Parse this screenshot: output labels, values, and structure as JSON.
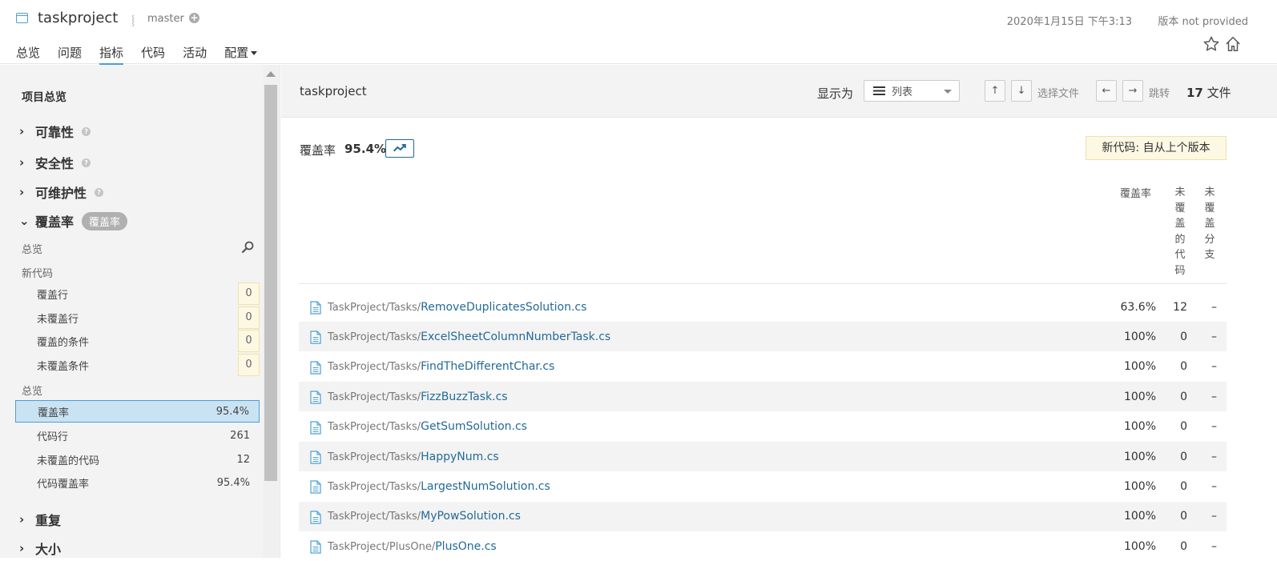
{
  "header": {
    "project_name": "taskproject",
    "branch": "master",
    "date": "2020年1月15日 下午3:13",
    "version": "版本 not provided",
    "nav": [
      "总览",
      "问题",
      "指标",
      "代码",
      "活动",
      "配置"
    ],
    "active_nav": "指标",
    "accent_color": "#4b9fd5"
  },
  "sidebar": {
    "title": "项目总览",
    "facets": {
      "reliability": "可靠性",
      "security": "安全性",
      "maintainability": "可维护性",
      "coverage": "覆盖率",
      "coverage_badge": "覆盖率",
      "duplications": "重复",
      "size": "大小"
    },
    "overview_label": "总览",
    "new_code_label": "新代码",
    "new_code_rows": [
      {
        "label": "覆盖行",
        "value": "0"
      },
      {
        "label": "未覆盖行",
        "value": "0"
      },
      {
        "label": "覆盖的条件",
        "value": "0"
      },
      {
        "label": "未覆盖条件",
        "value": "0"
      }
    ],
    "overall_label": "总览",
    "overall_rows": [
      {
        "label": "覆盖率",
        "value": "95.4%"
      },
      {
        "label": "代码行",
        "value": "261"
      },
      {
        "label": "未覆盖的代码",
        "value": "12"
      },
      {
        "label": "代码覆盖率",
        "value": "95.4%"
      }
    ]
  },
  "main": {
    "breadcrumb": "taskproject",
    "show_as_label": "显示为",
    "view_mode": "列表",
    "up_key": "↑",
    "down_key": "↓",
    "select_file_hint": "选择文件",
    "left_key": "←",
    "right_key": "→",
    "navigate_hint": "跳转",
    "files_count": "17",
    "files_label": "文件",
    "measure_label": "覆盖率",
    "measure_value": "95.4%",
    "new_code_period": "新代码: 自从上个版本",
    "columns": {
      "coverage": "覆盖率",
      "uncovered_lines": "未覆盖的代码",
      "uncovered_conditions": "未覆盖分支"
    },
    "files": [
      {
        "dir": "TaskProject/Tasks/",
        "name": "RemoveDuplicatesSolution.cs",
        "coverage": "63.6%",
        "uncovered": "12",
        "branches": "–"
      },
      {
        "dir": "TaskProject/Tasks/",
        "name": "ExcelSheetColumnNumberTask.cs",
        "coverage": "100%",
        "uncovered": "0",
        "branches": "–"
      },
      {
        "dir": "TaskProject/Tasks/",
        "name": "FindTheDifferentChar.cs",
        "coverage": "100%",
        "uncovered": "0",
        "branches": "–"
      },
      {
        "dir": "TaskProject/Tasks/",
        "name": "FizzBuzzTask.cs",
        "coverage": "100%",
        "uncovered": "0",
        "branches": "–"
      },
      {
        "dir": "TaskProject/Tasks/",
        "name": "GetSumSolution.cs",
        "coverage": "100%",
        "uncovered": "0",
        "branches": "–"
      },
      {
        "dir": "TaskProject/Tasks/",
        "name": "HappyNum.cs",
        "coverage": "100%",
        "uncovered": "0",
        "branches": "–"
      },
      {
        "dir": "TaskProject/Tasks/",
        "name": "LargestNumSolution.cs",
        "coverage": "100%",
        "uncovered": "0",
        "branches": "–"
      },
      {
        "dir": "TaskProject/Tasks/",
        "name": "MyPowSolution.cs",
        "coverage": "100%",
        "uncovered": "0",
        "branches": "–"
      },
      {
        "dir": "TaskProject/PlusOne/",
        "name": "PlusOne.cs",
        "coverage": "100%",
        "uncovered": "0",
        "branches": "–"
      }
    ]
  }
}
